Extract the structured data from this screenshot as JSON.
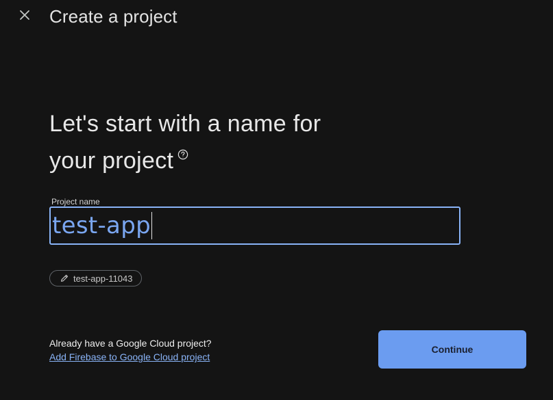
{
  "header": {
    "title": "Create a project",
    "close_icon": "close-icon"
  },
  "main": {
    "headline_line1": "Let's start with a name for",
    "headline_line2": "your project",
    "help_icon": "help-circle-icon"
  },
  "project_name_field": {
    "label": "Project name",
    "value": "test-app"
  },
  "project_id_chip": {
    "icon": "pencil-icon",
    "value": "test-app-11043"
  },
  "footer": {
    "cloud_question": "Already have a Google Cloud project?",
    "cloud_link": "Add Firebase to Google Cloud project",
    "continue_label": "Continue"
  },
  "colors": {
    "background": "#141414",
    "accent": "#8ab4f8",
    "button_fill": "#6b9cf0"
  }
}
